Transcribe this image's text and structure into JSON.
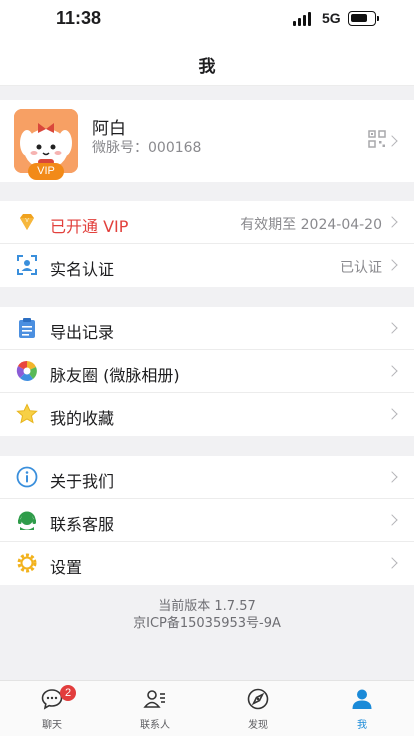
{
  "status": {
    "time": "11:38",
    "network": "5G"
  },
  "nav": {
    "title": "我"
  },
  "profile": {
    "name": "阿白",
    "id_label": "微脉号：000168",
    "vip_tag": "VIP"
  },
  "groups": [
    {
      "rows": [
        {
          "label": "已开通 VIP",
          "value": "有效期至 2024-04-20",
          "icon": "diamond-icon"
        },
        {
          "label": "实名认证",
          "value": "已认证",
          "icon": "id-scan-icon"
        }
      ]
    },
    {
      "rows": [
        {
          "label": "导出记录",
          "icon": "document-icon"
        },
        {
          "label": "脉友圈 (微脉相册)",
          "icon": "pinwheel-icon"
        },
        {
          "label": "我的收藏",
          "icon": "star-icon"
        }
      ]
    },
    {
      "rows": [
        {
          "label": "关于我们",
          "icon": "info-icon"
        },
        {
          "label": "联系客服",
          "icon": "headset-icon"
        },
        {
          "label": "设置",
          "icon": "gear-icon"
        }
      ]
    }
  ],
  "footer": {
    "version": "当前版本 1.7.57",
    "icp": "京ICP备15035953号-9A"
  },
  "tabs": [
    {
      "label": "聊天",
      "badge": "2",
      "icon": "chat-icon"
    },
    {
      "label": "联系人",
      "icon": "contacts-icon"
    },
    {
      "label": "发现",
      "icon": "compass-icon"
    },
    {
      "label": "我",
      "icon": "person-icon",
      "active": true
    }
  ],
  "colors": {
    "vip_red": "#e2403c",
    "accent_blue": "#1a8ad8",
    "vip_orange": "#f28a18"
  }
}
